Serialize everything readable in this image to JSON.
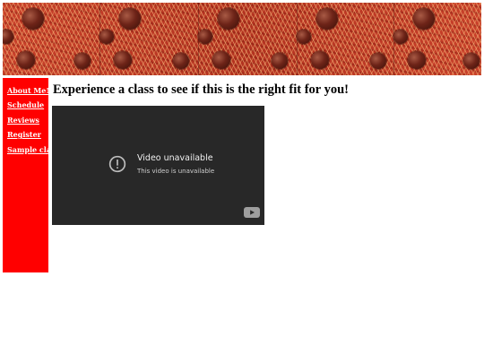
{
  "banner": {
    "image": "spaghetti-and-meatballs-pattern"
  },
  "sidebar": {
    "color": "#ff0000",
    "items": [
      {
        "label": "About Me!"
      },
      {
        "label": "Schedule"
      },
      {
        "label": "Reviews"
      },
      {
        "label": "Register"
      },
      {
        "label": "Sample class"
      }
    ]
  },
  "main": {
    "heading": "Experience a class to see if this is the right fit for you!"
  },
  "video": {
    "title": "Video unavailable",
    "message": "This video is unavailable",
    "icons": [
      "alert-circle-icon",
      "youtube-logo-icon"
    ]
  }
}
